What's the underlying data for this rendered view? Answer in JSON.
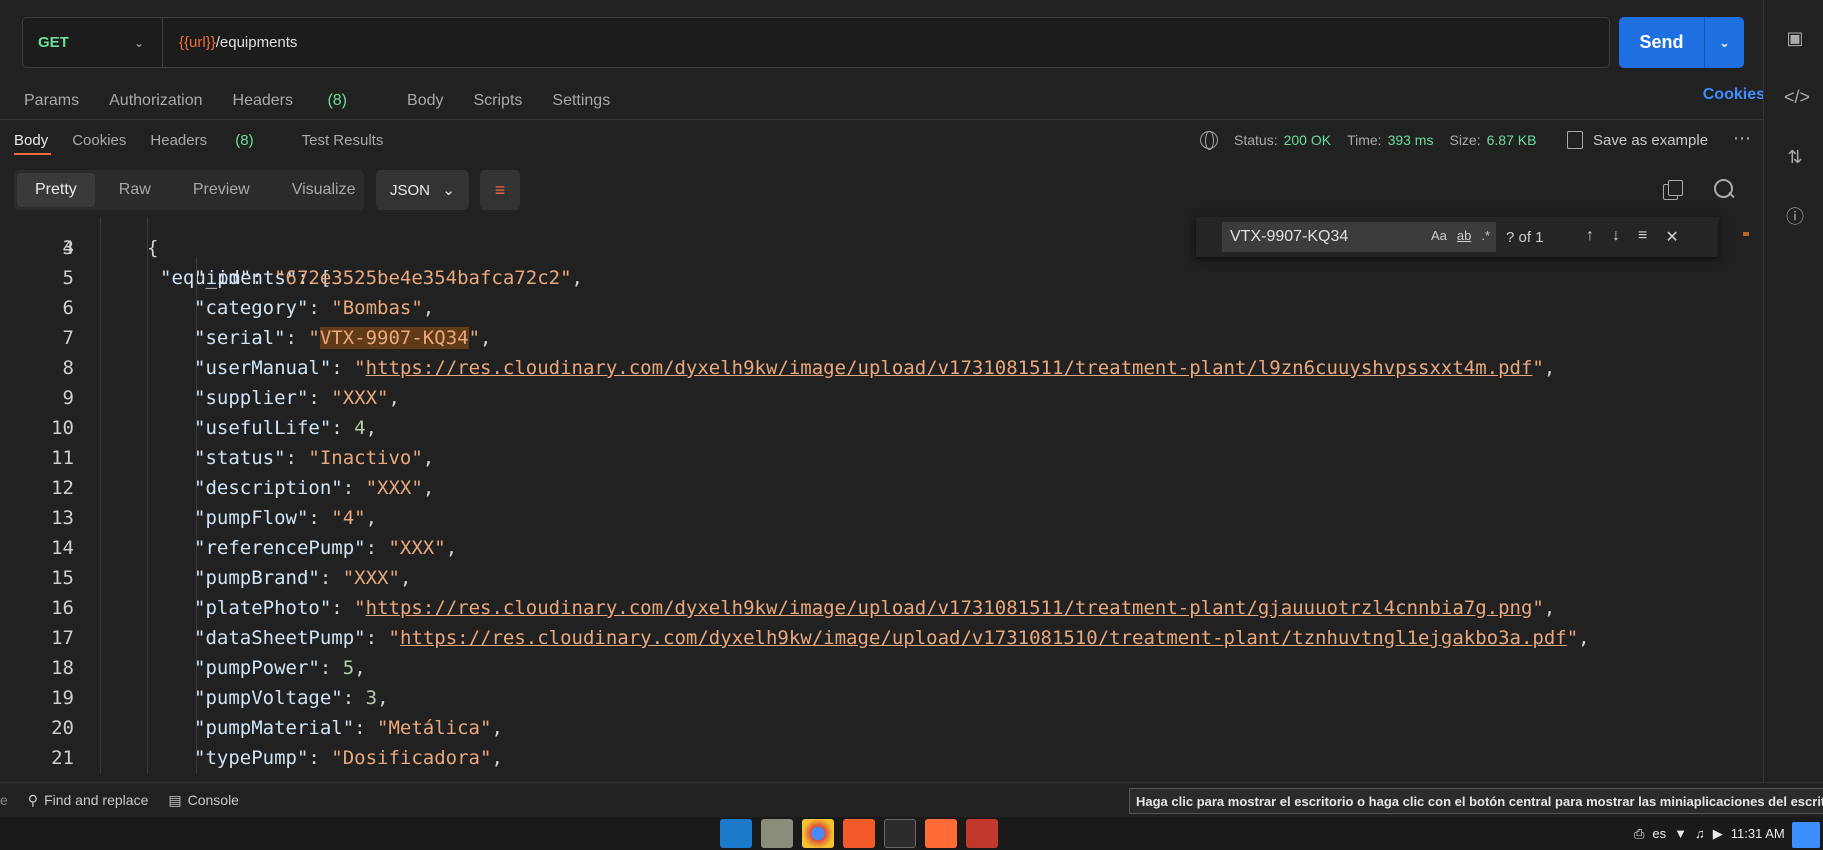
{
  "request": {
    "method": "GET",
    "url_var": "{{url}}",
    "url_path": "/equipments",
    "send_label": "Send"
  },
  "request_tabs": {
    "params": "Params",
    "authorization": "Authorization",
    "headers": "Headers",
    "headers_count": "(8)",
    "body": "Body",
    "scripts": "Scripts",
    "settings": "Settings",
    "cookies": "Cookies"
  },
  "response_tabs": {
    "body": "Body",
    "cookies": "Cookies",
    "headers": "Headers",
    "headers_count": "(8)",
    "test_results": "Test Results"
  },
  "response_meta": {
    "status_label": "Status:",
    "status_value": "200 OK",
    "time_label": "Time:",
    "time_value": "393 ms",
    "size_label": "Size:",
    "size_value": "6.87 KB",
    "save_example": "Save as example"
  },
  "format_bar": {
    "options": [
      "Pretty",
      "Raw",
      "Preview",
      "Visualize"
    ],
    "active": "Pretty",
    "language": "JSON"
  },
  "find": {
    "query": "VTX-9907-KQ34",
    "match_case": "Aa",
    "whole_word": "ab",
    "regex": ".*",
    "count": "? of 1"
  },
  "code_lines": [
    {
      "n": "4",
      "indent": 2,
      "tokens": [
        {
          "t": "p",
          "v": "{"
        }
      ]
    },
    {
      "n": "5",
      "indent": 3,
      "tokens": [
        {
          "t": "key",
          "v": "\"_id\""
        },
        {
          "t": "p",
          "v": ": "
        },
        {
          "t": "str",
          "v": "\"672e3525be4e354bafca72c2\""
        },
        {
          "t": "p",
          "v": ","
        }
      ]
    },
    {
      "n": "6",
      "indent": 3,
      "tokens": [
        {
          "t": "key",
          "v": "\"category\""
        },
        {
          "t": "p",
          "v": ": "
        },
        {
          "t": "str",
          "v": "\"Bombas\""
        },
        {
          "t": "p",
          "v": ","
        }
      ]
    },
    {
      "n": "7",
      "indent": 3,
      "tokens": [
        {
          "t": "key",
          "v": "\"serial\""
        },
        {
          "t": "p",
          "v": ": "
        },
        {
          "t": "str",
          "v": "\""
        },
        {
          "t": "hl",
          "v": "VTX-9907-KQ34"
        },
        {
          "t": "str",
          "v": "\""
        },
        {
          "t": "p",
          "v": ","
        }
      ]
    },
    {
      "n": "8",
      "indent": 3,
      "tokens": [
        {
          "t": "key",
          "v": "\"userManual\""
        },
        {
          "t": "p",
          "v": ": "
        },
        {
          "t": "str",
          "v": "\""
        },
        {
          "t": "url",
          "v": "https://res.cloudinary.com/dyxelh9kw/image/upload/v1731081511/treatment-plant/l9zn6cuuyshvpssxxt4m.pdf"
        },
        {
          "t": "str",
          "v": "\""
        },
        {
          "t": "p",
          "v": ","
        }
      ]
    },
    {
      "n": "9",
      "indent": 3,
      "tokens": [
        {
          "t": "key",
          "v": "\"supplier\""
        },
        {
          "t": "p",
          "v": ": "
        },
        {
          "t": "str",
          "v": "\"XXX\""
        },
        {
          "t": "p",
          "v": ","
        }
      ]
    },
    {
      "n": "10",
      "indent": 3,
      "tokens": [
        {
          "t": "key",
          "v": "\"usefulLife\""
        },
        {
          "t": "p",
          "v": ": "
        },
        {
          "t": "num",
          "v": "4"
        },
        {
          "t": "p",
          "v": ","
        }
      ]
    },
    {
      "n": "11",
      "indent": 3,
      "tokens": [
        {
          "t": "key",
          "v": "\"status\""
        },
        {
          "t": "p",
          "v": ": "
        },
        {
          "t": "str",
          "v": "\"Inactivo\""
        },
        {
          "t": "p",
          "v": ","
        }
      ]
    },
    {
      "n": "12",
      "indent": 3,
      "tokens": [
        {
          "t": "key",
          "v": "\"description\""
        },
        {
          "t": "p",
          "v": ": "
        },
        {
          "t": "str",
          "v": "\"XXX\""
        },
        {
          "t": "p",
          "v": ","
        }
      ]
    },
    {
      "n": "13",
      "indent": 3,
      "tokens": [
        {
          "t": "key",
          "v": "\"pumpFlow\""
        },
        {
          "t": "p",
          "v": ": "
        },
        {
          "t": "str",
          "v": "\"4\""
        },
        {
          "t": "p",
          "v": ","
        }
      ]
    },
    {
      "n": "14",
      "indent": 3,
      "tokens": [
        {
          "t": "key",
          "v": "\"referencePump\""
        },
        {
          "t": "p",
          "v": ": "
        },
        {
          "t": "str",
          "v": "\"XXX\""
        },
        {
          "t": "p",
          "v": ","
        }
      ]
    },
    {
      "n": "15",
      "indent": 3,
      "tokens": [
        {
          "t": "key",
          "v": "\"pumpBrand\""
        },
        {
          "t": "p",
          "v": ": "
        },
        {
          "t": "str",
          "v": "\"XXX\""
        },
        {
          "t": "p",
          "v": ","
        }
      ]
    },
    {
      "n": "16",
      "indent": 3,
      "tokens": [
        {
          "t": "key",
          "v": "\"platePhoto\""
        },
        {
          "t": "p",
          "v": ": "
        },
        {
          "t": "str",
          "v": "\""
        },
        {
          "t": "url",
          "v": "https://res.cloudinary.com/dyxelh9kw/image/upload/v1731081511/treatment-plant/gjauuuotrzl4cnnbia7g.png"
        },
        {
          "t": "str",
          "v": "\""
        },
        {
          "t": "p",
          "v": ","
        }
      ]
    },
    {
      "n": "17",
      "indent": 3,
      "tokens": [
        {
          "t": "key",
          "v": "\"dataSheetPump\""
        },
        {
          "t": "p",
          "v": ": "
        },
        {
          "t": "str",
          "v": "\""
        },
        {
          "t": "url",
          "v": "https://res.cloudinary.com/dyxelh9kw/image/upload/v1731081510/treatment-plant/tznhuvtngl1ejgakbo3a.pdf"
        },
        {
          "t": "str",
          "v": "\""
        },
        {
          "t": "p",
          "v": ","
        }
      ]
    },
    {
      "n": "18",
      "indent": 3,
      "tokens": [
        {
          "t": "key",
          "v": "\"pumpPower\""
        },
        {
          "t": "p",
          "v": ": "
        },
        {
          "t": "num",
          "v": "5"
        },
        {
          "t": "p",
          "v": ","
        }
      ]
    },
    {
      "n": "19",
      "indent": 3,
      "tokens": [
        {
          "t": "key",
          "v": "\"pumpVoltage\""
        },
        {
          "t": "p",
          "v": ": "
        },
        {
          "t": "num",
          "v": "3"
        },
        {
          "t": "p",
          "v": ","
        }
      ]
    },
    {
      "n": "20",
      "indent": 3,
      "tokens": [
        {
          "t": "key",
          "v": "\"pumpMaterial\""
        },
        {
          "t": "p",
          "v": ": "
        },
        {
          "t": "str",
          "v": "\"Metálica\""
        },
        {
          "t": "p",
          "v": ","
        }
      ]
    },
    {
      "n": "21",
      "indent": 3,
      "tokens": [
        {
          "t": "key",
          "v": "\"typePump\""
        },
        {
          "t": "p",
          "v": ": "
        },
        {
          "t": "str",
          "v": "\"Dosificadora\""
        },
        {
          "t": "p",
          "v": ","
        }
      ]
    }
  ],
  "statusbar": {
    "find_replace": "Find and replace",
    "console": "Console",
    "tooltip": "Haga clic para mostrar el escritorio o haga clic con el botón central para mostrar las miniaplicaciones del escritorio"
  },
  "tray": {
    "lang": "es",
    "time": "11:31 AM"
  },
  "colors": {
    "accent": "#f26b3a",
    "send": "#1e6fe0",
    "status_ok": "#6bdd9a",
    "link": "#3d8eff"
  }
}
